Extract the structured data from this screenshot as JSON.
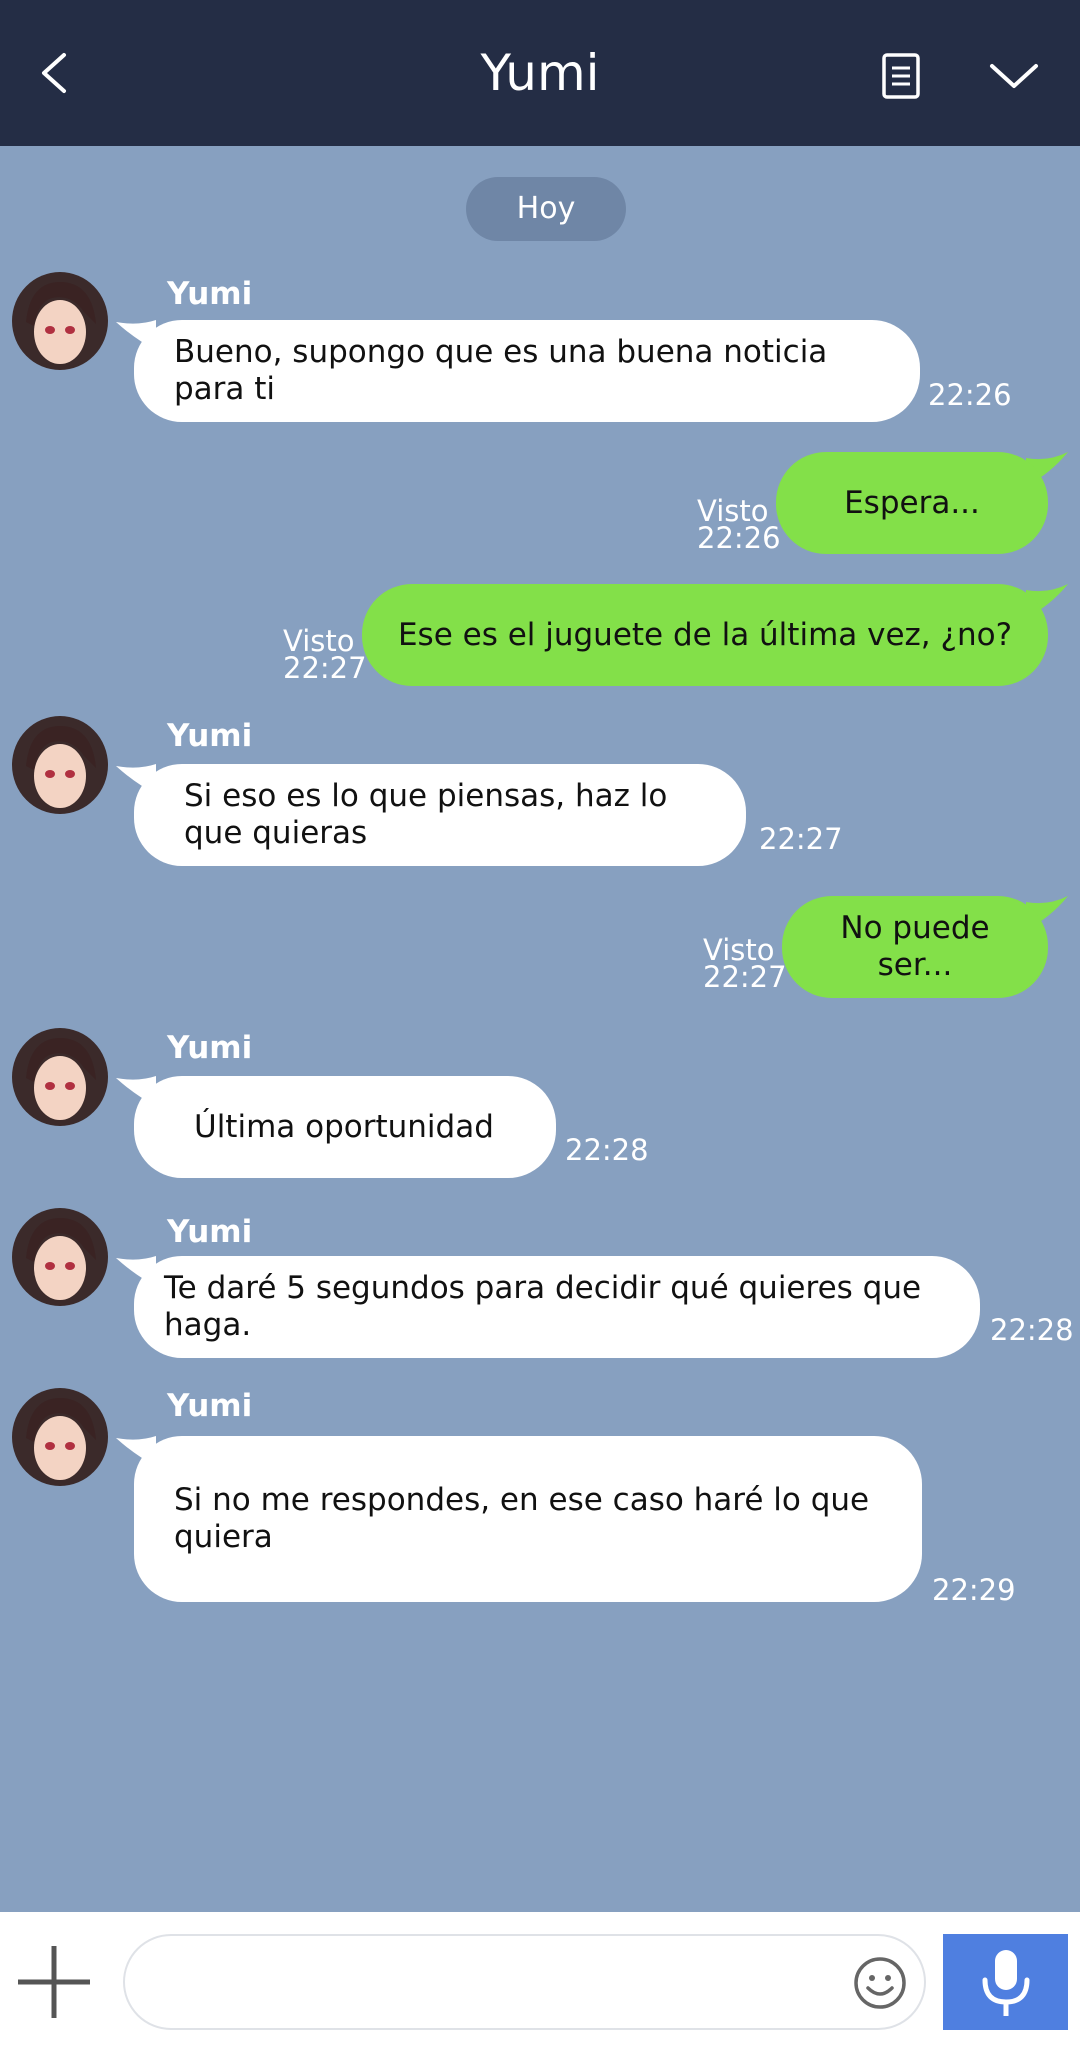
{
  "header": {
    "title": "Yumi",
    "back_icon": "chevron-left-icon",
    "notes_icon": "notes-icon",
    "menu_icon": "chevron-down-icon"
  },
  "date_separator": "Hoy",
  "messages": [
    {
      "from": "Yumi",
      "side": "in",
      "sender": "Yumi",
      "text": "Bueno, supongo que es una buena noticia para ti",
      "time": "22:26"
    },
    {
      "side": "out",
      "text": "Espera...",
      "status": "Visto",
      "time": "22:26"
    },
    {
      "side": "out",
      "text": "Ese es el juguete de la última vez, ¿no?",
      "status": "Visto",
      "time": "22:27"
    },
    {
      "side": "in",
      "sender": "Yumi",
      "text": "Si eso es lo que piensas, haz lo que quieras",
      "time": "22:27"
    },
    {
      "side": "out",
      "text": "No puede ser...",
      "status": "Visto",
      "time": "22:27"
    },
    {
      "side": "in",
      "sender": "Yumi",
      "text": "Última oportunidad",
      "time": "22:28"
    },
    {
      "side": "in",
      "sender": "Yumi",
      "text": "Te daré 5 segundos para decidir qué quieres que haga.",
      "time": "22:28"
    },
    {
      "side": "in",
      "sender": "Yumi",
      "text": "Si no me respondes, en ese caso haré lo que quiera",
      "time": "22:29"
    }
  ],
  "composer": {
    "placeholder": "",
    "plus_icon": "plus-icon",
    "emoji_icon": "emoji-icon",
    "mic_icon": "microphone-icon"
  },
  "colors": {
    "header_bg": "#242d45",
    "chat_bg": "#87a0c0",
    "incoming_bubble": "#ffffff",
    "outgoing_bubble": "#83e049",
    "mic_button": "#4f7fe0"
  }
}
